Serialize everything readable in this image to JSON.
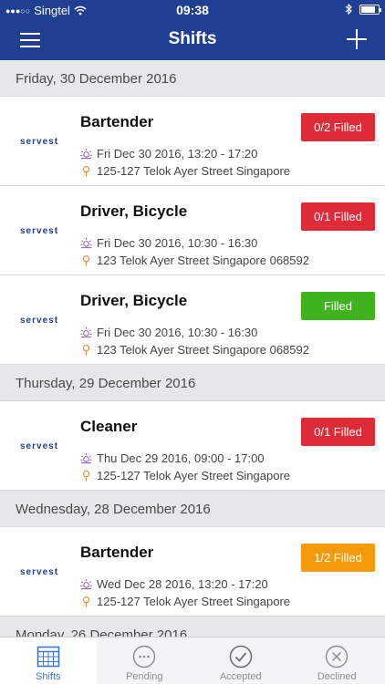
{
  "status_bar": {
    "carrier": "Singtel",
    "signal_dots": "●●●○○",
    "time": "09:38"
  },
  "nav": {
    "title": "Shifts"
  },
  "days": [
    {
      "header": "Friday, 30 December 2016",
      "shifts": [
        {
          "logo": "servest",
          "role": "Bartender",
          "when": "Fri Dec 30 2016, 13:20 - 17:20",
          "where": "125-127 Telok Ayer Street Singapore",
          "badge": "0/2 Filled",
          "badge_color": "#dd2b37"
        },
        {
          "logo": "servest",
          "role": "Driver, Bicycle",
          "when": "Fri Dec 30 2016, 10:30 - 16:30",
          "where": "123 Telok Ayer Street Singapore 068592",
          "badge": "0/1 Filled",
          "badge_color": "#dd2b37"
        },
        {
          "logo": "servest",
          "role": "Driver, Bicycle",
          "when": "Fri Dec 30 2016, 10:30 - 16:30",
          "where": "123 Telok Ayer Street Singapore 068592",
          "badge": "Filled",
          "badge_color": "#3fb31c"
        }
      ]
    },
    {
      "header": "Thursday, 29 December 2016",
      "shifts": [
        {
          "logo": "servest",
          "role": "Cleaner",
          "when": "Thu Dec 29 2016, 09:00 - 17:00",
          "where": "125-127 Telok Ayer Street Singapore",
          "badge": "0/1 Filled",
          "badge_color": "#dd2b37"
        }
      ]
    },
    {
      "header": "Wednesday, 28 December 2016",
      "shifts": [
        {
          "logo": "servest",
          "role": "Bartender",
          "when": "Wed Dec 28 2016, 13:20 - 17:20",
          "where": "125-127 Telok Ayer Street Singapore",
          "badge": "1/2 Filled",
          "badge_color": "#f59a0a"
        }
      ]
    },
    {
      "header": "Monday, 26 December 2016",
      "shifts": []
    }
  ],
  "tabs": [
    {
      "label": "Shifts",
      "icon": "calendar-icon",
      "active": true
    },
    {
      "label": "Pending",
      "icon": "ellipsis-circle-icon",
      "active": false
    },
    {
      "label": "Accepted",
      "icon": "check-circle-icon",
      "active": false
    },
    {
      "label": "Declined",
      "icon": "x-circle-icon",
      "active": false
    }
  ],
  "colors": {
    "brand": "#1f3f93",
    "danger": "#dd2b37",
    "success": "#3fb31c",
    "warning": "#f59a0a",
    "tab_active": "#3a78d9"
  }
}
